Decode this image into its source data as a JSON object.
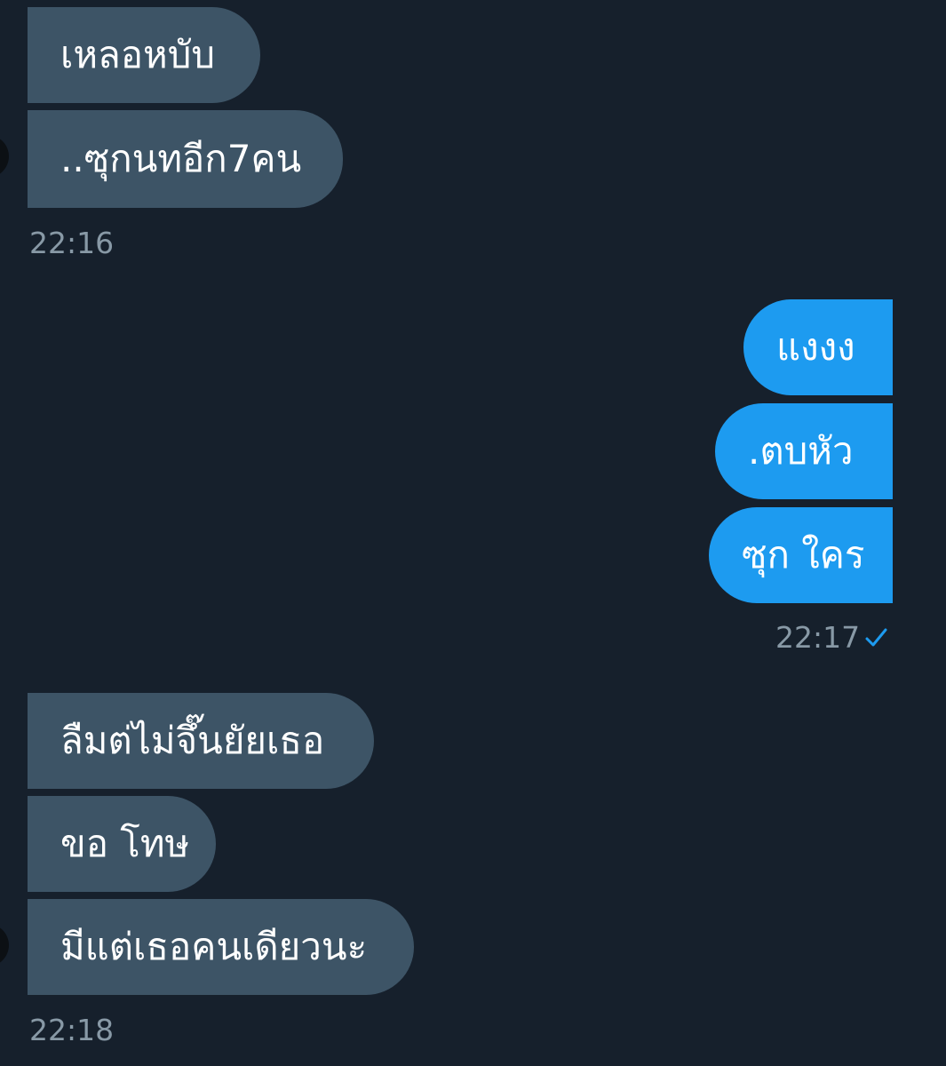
{
  "conversation": {
    "groups": [
      {
        "direction": "incoming",
        "messages": [
          "เหลอหบับ",
          "..ซุกนทอีก7คน"
        ],
        "time": "22:16"
      },
      {
        "direction": "outgoing",
        "messages": [
          "แงงง",
          ".ตบหัว",
          "ซุก ใคร"
        ],
        "time": "22:17",
        "status": "sent-check-icon"
      },
      {
        "direction": "incoming",
        "messages": [
          "ลืมต่ไม่จึ๊นยัยเธอ",
          "ขอ โทษ",
          "มีแต่เธอคนเดียวนะ"
        ],
        "time": "22:18"
      }
    ]
  },
  "colors": {
    "background": "#16202c",
    "incoming_bubble": "#3d5466",
    "outgoing_bubble": "#1d9bf0",
    "timestamp": "#8899a6",
    "check": "#1d9bf0",
    "text": "#ffffff"
  }
}
